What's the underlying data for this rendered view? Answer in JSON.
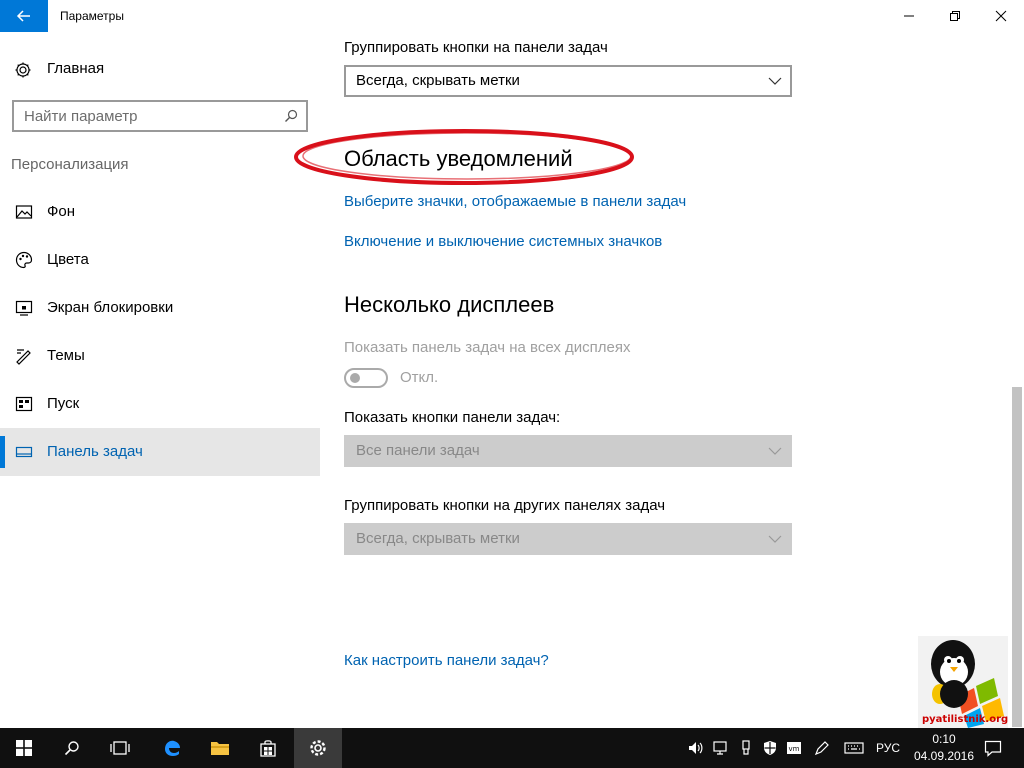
{
  "window": {
    "title": "Параметры",
    "back_icon": "arrow-left-icon",
    "controls": [
      "minimize-icon",
      "maximize-icon",
      "close-icon"
    ]
  },
  "sidebar": {
    "home_label": "Главная",
    "search_placeholder": "Найти параметр",
    "section_header": "Персонализация",
    "items": [
      {
        "label": "Фон",
        "icon": "image-icon"
      },
      {
        "label": "Цвета",
        "icon": "palette-icon"
      },
      {
        "label": "Экран блокировки",
        "icon": "lock-screen-icon"
      },
      {
        "label": "Темы",
        "icon": "themes-icon"
      },
      {
        "label": "Пуск",
        "icon": "start-icon"
      },
      {
        "label": "Панель задач",
        "icon": "taskbar-icon",
        "active": true
      }
    ]
  },
  "main": {
    "group_buttons_label": "Группировать кнопки на панели задач",
    "group_buttons_value": "Всегда, скрывать метки",
    "notification_area_heading": "Область уведомлений",
    "link_select_icons": "Выберите значки, отображаемые в панели задач",
    "link_system_icons": "Включение и выключение системных значков",
    "multiple_displays_heading": "Несколько дисплеев",
    "show_taskbar_all_displays_label": "Показать панель задач на всех дисплеях",
    "toggle_state": "Откл.",
    "show_buttons_label": "Показать кнопки панели задач:",
    "show_buttons_value": "Все панели задач",
    "group_other_label": "Группировать кнопки на других панелях задач",
    "group_other_value": "Всегда, скрывать метки",
    "help_link": "Как настроить панели задач?"
  },
  "watermark": {
    "text": "pyatilistnik.org"
  },
  "taskbar": {
    "language": "РУС",
    "time": "0:10",
    "date": "04.09.2016"
  },
  "colors": {
    "accent": "#0078d7",
    "link": "#0063b1",
    "highlight_ellipse": "#d9101a",
    "taskbar": "#101010"
  }
}
